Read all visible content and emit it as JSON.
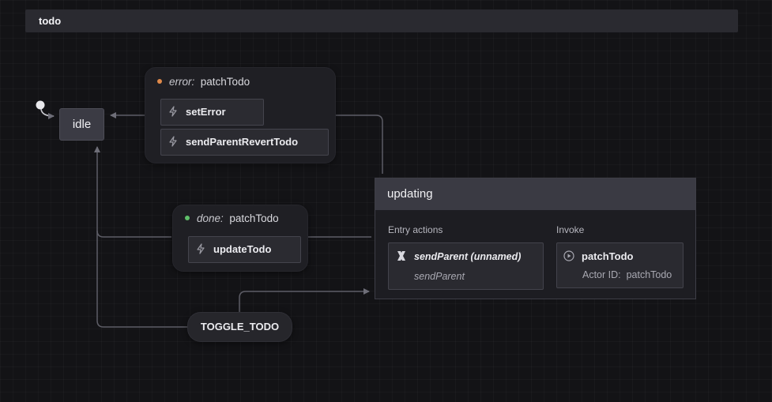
{
  "machine": {
    "name": "todo"
  },
  "states": {
    "idle": {
      "label": "idle"
    },
    "updating": {
      "label": "updating",
      "entry_actions_label": "Entry actions",
      "entry_action": {
        "title": "sendParent (unnamed)",
        "subtitle": "sendParent"
      },
      "invoke_label": "Invoke",
      "invoke": {
        "title": "patchTodo",
        "actor_label": "Actor ID:",
        "actor_id": "patchTodo"
      }
    }
  },
  "transitions": {
    "error": {
      "kind": "error:",
      "source": "patchTodo",
      "dot_color": "#e0894a",
      "actions": [
        "setError",
        "sendParentRevertTodo"
      ]
    },
    "done": {
      "kind": "done:",
      "source": "patchTodo",
      "dot_color": "#5fbf6a",
      "actions": [
        "updateTodo"
      ]
    },
    "toggle": {
      "label": "TOGGLE_TODO"
    }
  },
  "colors": {
    "wire": "#6e6e78",
    "background": "#131316"
  }
}
